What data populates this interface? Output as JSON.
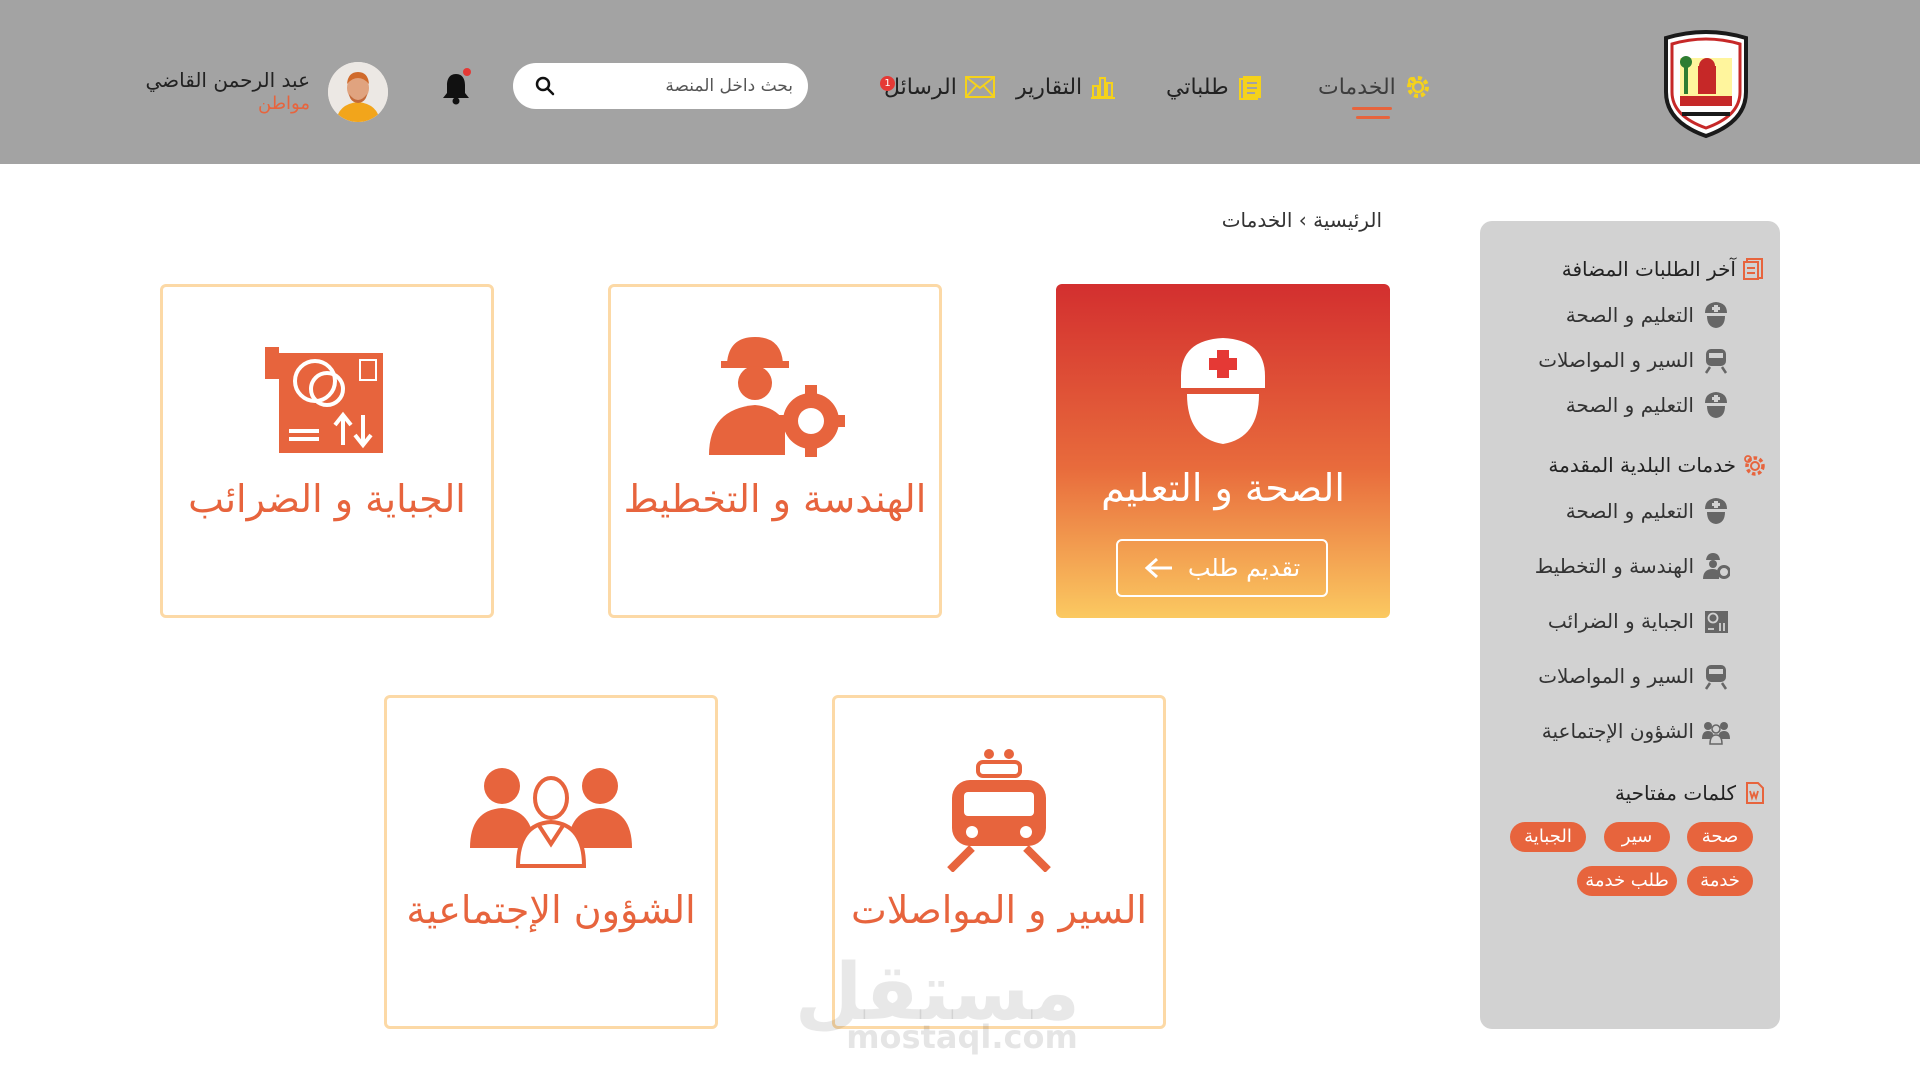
{
  "header": {
    "logo_alt": "AL-TIRA MUNICIPALITY",
    "nav": {
      "services": "الخدمات",
      "my_requests": "طلباتي",
      "reports": "التقارير",
      "messages": "الرسائل",
      "messages_badge": "1"
    },
    "search_placeholder": "بحث داخل المنصة",
    "user": {
      "name": "عبد الرحمن القاضي",
      "role": "مواطن"
    }
  },
  "breadcrumb": {
    "home": "الرئيسية",
    "separator": "›",
    "current": "الخدمات"
  },
  "cards": {
    "health": {
      "title": "الصحة و التعليم",
      "button": "تقديم طلب"
    },
    "engineering": {
      "title": "الهندسة و التخطيط"
    },
    "taxes": {
      "title": "الجباية  و الضرائب"
    },
    "transport": {
      "title": "السير  و المواصلات"
    },
    "social": {
      "title": "الشؤون الإجتماعية"
    }
  },
  "sidebar": {
    "recent_heading": "آخر الطلبات المضافة",
    "recent": [
      "التعليم و الصحة",
      "السير و المواصلات",
      "التعليم و الصحة"
    ],
    "services_heading": "خدمات البلدية المقدمة",
    "services": [
      "التعليم و الصحة",
      "الهندسة و التخطيط",
      "الجباية  و الضرائب",
      "السير  و المواصلات",
      "الشؤون الإجتماعية"
    ],
    "keywords_heading": "كلمات مفتاحية",
    "tags": [
      "صحة",
      "سير",
      "الجباية",
      "خدمة",
      "طلب خدمة"
    ]
  },
  "watermark": {
    "arabic": "مستقل",
    "latin": "mostaql.com"
  },
  "colors": {
    "accent": "#e7643d",
    "header_bg": "#a3a3a3",
    "sidebar_bg": "#d2d2d2",
    "card_border": "#fcd9a6",
    "icon_yellow": "#f5d21b"
  }
}
